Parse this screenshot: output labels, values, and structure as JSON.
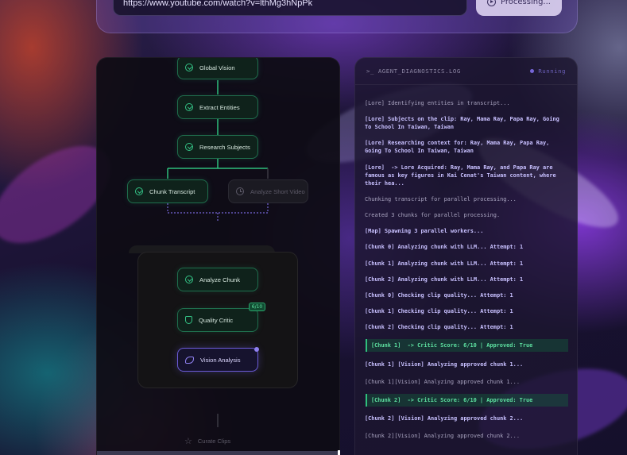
{
  "url_bar": {
    "value": "https://www.youtube.com/watch?v=lthMg3hNpPk",
    "button_label": "Processing..."
  },
  "flow": {
    "nodes": {
      "global_vision": "Global Vision",
      "extract_entities": "Extract Entities",
      "research_subjects": "Research Subjects",
      "chunk_transcript": "Chunk Transcript",
      "analyze_short_video": "Analyze Short Video",
      "analyze_chunk": "Analyze Chunk",
      "quality_critic": "Quality Critic",
      "vision_analysis": "Vision Analysis",
      "curate_clips": "Curate Clips"
    },
    "critic_badge": "6/10"
  },
  "diagnostics": {
    "title": ">_ AGENT_DIAGNOSTICS.LOG",
    "status": "Running",
    "lines": [
      {
        "text": "[Lore] Identifying entities in transcript...",
        "style": "normal"
      },
      {
        "text": "[Lore] Subjects on the clip: Ray, Mama Ray, Papa Ray, Going To School In Taiwan, Taiwan",
        "style": "bold"
      },
      {
        "text": "[Lore] Researching context for: Ray, Mama Ray, Papa Ray, Going To School In Taiwan, Taiwan",
        "style": "bold"
      },
      {
        "text": "[Lore]  -> Lore Acquired: Ray, Mama Ray, and Papa Ray are famous as key figures in Kai Cenat's Taiwan content, where their hea...",
        "style": "bold"
      },
      {
        "text": "Chunking transcript for parallel processing...",
        "style": "normal"
      },
      {
        "text": "Created 3 chunks for parallel processing.",
        "style": "normal"
      },
      {
        "text": "[Map] Spawning 3 parallel workers...",
        "style": "bold"
      },
      {
        "text": "[Chunk 0] Analyzing chunk with LLM... Attempt: 1",
        "style": "bold"
      },
      {
        "text": "[Chunk 1] Analyzing chunk with LLM... Attempt: 1",
        "style": "bold"
      },
      {
        "text": "[Chunk 2] Analyzing chunk with LLM... Attempt: 1",
        "style": "bold"
      },
      {
        "text": "[Chunk 0] Checking clip quality... Attempt: 1",
        "style": "bold"
      },
      {
        "text": "[Chunk 1] Checking clip quality... Attempt: 1",
        "style": "bold"
      },
      {
        "text": "[Chunk 2] Checking clip quality... Attempt: 1",
        "style": "bold"
      },
      {
        "text": "[Chunk 1]  -> Critic Score: 6/10 | Approved: True",
        "style": "green"
      },
      {
        "text": "[Chunk 1] [Vision] Analyzing approved chunk 1...",
        "style": "bold"
      },
      {
        "text": "[Chunk 1][Vision] Analyzing approved chunk 1...",
        "style": "normal-gap"
      },
      {
        "text": "[Chunk 2]  -> Critic Score: 6/10 | Approved: True",
        "style": "green"
      },
      {
        "text": "[Chunk 2] [Vision] Analyzing approved chunk 2...",
        "style": "bold"
      },
      {
        "text": "[Chunk 2][Vision] Analyzing approved chunk 2...",
        "style": "normal-gap"
      }
    ]
  },
  "colors": {
    "accent_green": "#34c486",
    "accent_purple": "#7666d8",
    "panel_dark": "#0e0c14"
  }
}
